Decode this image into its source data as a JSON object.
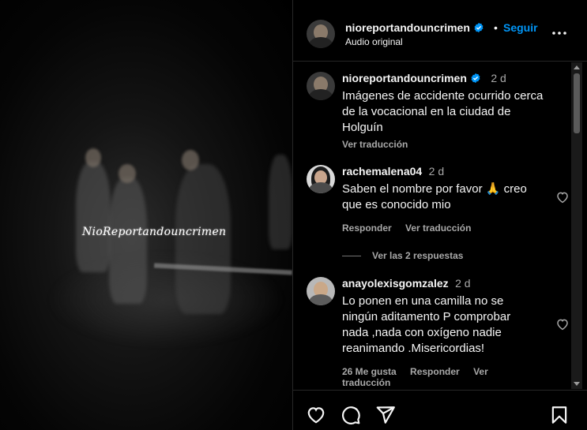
{
  "video": {
    "watermark": "NioReportandouncrimen"
  },
  "header": {
    "username": "nioreportandouncrimen",
    "separator": "•",
    "follow_label": "Seguir",
    "audio_label": "Audio original",
    "more_icon": "more-horizontal-icon"
  },
  "caption": {
    "username": "nioreportandouncrimen",
    "time": "2 d",
    "text": "Imágenes de accidente ocurrido cerca de la vocacional en la ciudad de Holguín",
    "translate_label": "Ver traducción"
  },
  "comments": [
    {
      "username": "rachemalena04",
      "time": "2 d",
      "text": "Saben el nombre por favor 🙏 creo que es conocido mio",
      "reply_label": "Responder",
      "translate_label": "Ver traducción",
      "view_replies_label": "Ver las 2 respuestas"
    },
    {
      "username": "anayolexisgomzalez",
      "time": "2 d",
      "text": "Lo ponen en una camilla no se ningún aditamento P comprobar nada ,nada con oxígeno nadie reanimando .Misericordias!",
      "likes_label": "26 Me gusta",
      "reply_label": "Responder",
      "translate_label": "Ver traducción"
    }
  ],
  "footer": {
    "icons": [
      "heart-icon",
      "comment-icon",
      "share-icon",
      "bookmark-icon"
    ]
  },
  "colors": {
    "background": "#000000",
    "accent": "#0095f6",
    "verified": "#0095f6",
    "muted_text": "#a8a8a8"
  }
}
